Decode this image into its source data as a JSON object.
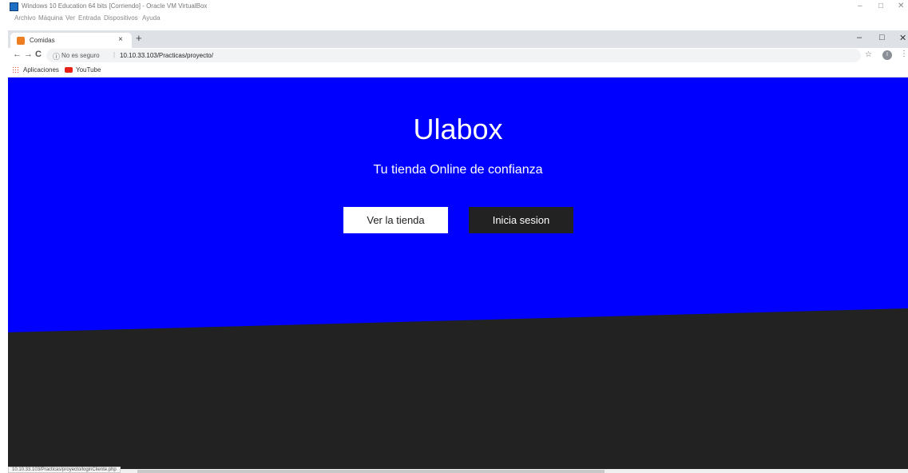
{
  "vm_window": {
    "title": "Windows 10 Education 64 bits [Corriendo] - Oracle VM VirtualBox",
    "menu": [
      "Archivo",
      "Máquina",
      "Ver",
      "Entrada",
      "Dispositivos",
      "Ayuda"
    ],
    "controls": {
      "minimize": "–",
      "restore": "□",
      "close": "✕"
    }
  },
  "browser": {
    "tab_title": "Comidas",
    "tab_close": "×",
    "new_tab": "+",
    "controls": {
      "minimize": "–",
      "restore": "□",
      "close": "✕"
    },
    "nav": {
      "back": "←",
      "forward": "→",
      "reload": "C"
    },
    "omnibox": {
      "info_icon": "ⓘ",
      "security_text": "No es seguro",
      "separator": "|",
      "url": "10.10.33.103/Practicas/proyecto/"
    },
    "star": "☆",
    "profile_initial": "I",
    "menu_dots": "⋮",
    "bookmarks": [
      {
        "label": "Aplicaciones",
        "icon": "apps-grid-icon"
      },
      {
        "label": "YouTube",
        "icon": "youtube-icon"
      }
    ],
    "status_url": "10.10.33.103/Practicas/proyecto/loginCliente.php"
  },
  "page": {
    "title": "Ulabox",
    "subtitle": "Tu tienda Online de confianza",
    "buttons": {
      "shop": "Ver la tienda",
      "login": "Inicia sesion"
    }
  },
  "colors": {
    "hero_blue": "#0000ff",
    "dark": "#222222",
    "white": "#ffffff"
  }
}
